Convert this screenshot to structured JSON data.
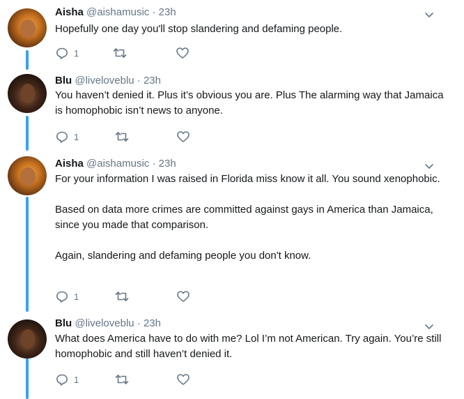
{
  "tweets": [
    {
      "name": "Aisha",
      "handle": "@aishamusic",
      "sep": "·",
      "time": "23h",
      "paragraphs": [
        "Hopefully one day you'll stop slandering and defaming people."
      ],
      "replies": "1",
      "avatar": "aisha-avatar"
    },
    {
      "name": "Blu",
      "handle": "@liveloveblu",
      "sep": "·",
      "time": "23h",
      "paragraphs": [
        "You haven’t denied it. Plus it’s obvious you are. Plus The alarming way that Jamaica is homophobic isn’t news to anyone."
      ],
      "replies": "1",
      "avatar": "blu-avatar"
    },
    {
      "name": "Aisha",
      "handle": "@aishamusic",
      "sep": "·",
      "time": "23h",
      "paragraphs": [
        "For your information I was raised in Florida miss know it all. You sound xenophobic.",
        "Based on data more crimes are committed against gays in America than Jamaica, since you made that comparison.",
        "Again, slandering and defaming people you don't know."
      ],
      "replies": "1",
      "avatar": "aisha-avatar"
    },
    {
      "name": "Blu",
      "handle": "@liveloveblu",
      "sep": "·",
      "time": "23h",
      "paragraphs": [
        "What does America have to do with me? Lol I’m not American. Try again. You’re still homophobic and still haven’t denied it."
      ],
      "replies": "1",
      "avatar": "blu-avatar"
    }
  ],
  "icons": {
    "reply": "reply-icon",
    "retweet": "retweet-icon",
    "like": "heart-icon",
    "menu": "chevron-down-icon"
  },
  "colors": {
    "thread_line": "#38a1f3",
    "secondary_text": "#657786",
    "primary_text": "#14171a"
  }
}
